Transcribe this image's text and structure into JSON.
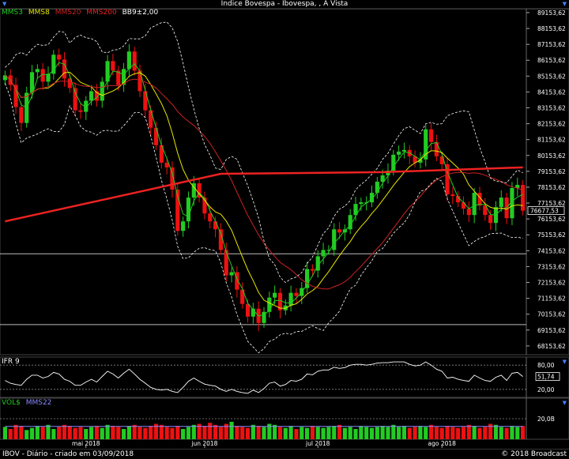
{
  "window": {
    "title": "Indice Bovespa - Ibovespa, , A Vista"
  },
  "legend_main": [
    {
      "label": "MMS3",
      "color": "#22cc22"
    },
    {
      "label": "MMS8",
      "color": "#e6e600"
    },
    {
      "label": "MMS20",
      "color": "#cc2222"
    },
    {
      "label": "MMS200",
      "color": "#ee2222"
    },
    {
      "label": "BB9±2,00",
      "color": "#ffffff"
    }
  ],
  "legend_ifr": {
    "label": "IFR 9",
    "color": "#ffffff"
  },
  "legend_vol": [
    {
      "label": "VOL$",
      "color": "#22cc22"
    },
    {
      "label": "MMS22",
      "color": "#8888ff"
    }
  ],
  "footer": {
    "left": "IBOV - Diário - criado em 03/09/2018",
    "right": "© 2018 Broadcast"
  },
  "colors": {
    "up": "#22cc22",
    "down": "#ee1111",
    "accent": "#4a7cff"
  },
  "chart_data": [
    {
      "type": "candlestick",
      "y_tick_labels": [
        "89153,62",
        "88153,62",
        "87153,62",
        "86153,62",
        "85153,62",
        "84153,62",
        "83153,62",
        "82153,62",
        "81153,62",
        "80153,62",
        "79153,62",
        "78153,62",
        "77153,62",
        "76153,62",
        "75153,62",
        "74153,62",
        "73153,62",
        "72153,62",
        "71153,62",
        "70153,62",
        "69153,62",
        "68153,62"
      ],
      "ylim": [
        67600,
        89400
      ],
      "last_value_label": "76677,53",
      "last_value": 76677.53,
      "horizontal_lines": [
        73960,
        69500
      ],
      "x_tick_labels": [
        {
          "label": "mai 2018",
          "index": 15
        },
        {
          "label": "jun 2018",
          "index": 37
        },
        {
          "label": "jul 2018",
          "index": 58
        },
        {
          "label": "ago 2018",
          "index": 81
        }
      ],
      "closes": [
        85200,
        84600,
        83200,
        82200,
        84100,
        85400,
        85600,
        84800,
        85300,
        86500,
        86200,
        85000,
        84400,
        83000,
        82900,
        83600,
        84200,
        83600,
        84800,
        86100,
        85500,
        84600,
        85600,
        86700,
        85500,
        84200,
        83000,
        81900,
        80800,
        79700,
        79400,
        78000,
        75400,
        76000,
        77500,
        78400,
        77500,
        76500,
        76000,
        75500,
        74200,
        72600,
        72800,
        71700,
        70800,
        70000,
        70500,
        69600,
        70300,
        71200,
        71500,
        70400,
        70700,
        71500,
        71300,
        71800,
        73000,
        72900,
        73800,
        74200,
        74200,
        75500,
        75300,
        75500,
        76400,
        77100,
        77200,
        77200,
        77800,
        78500,
        78900,
        79200,
        80200,
        80400,
        80500,
        80100,
        79700,
        79900,
        81800,
        81000,
        80100,
        79600,
        77700,
        77600,
        77200,
        76800,
        76400,
        77800,
        77000,
        76400,
        75900,
        76900,
        77500,
        76200,
        78100,
        78300,
        76677.53
      ],
      "ma_series": [
        {
          "name": "MMS3",
          "period": 3,
          "color": "#22cc22"
        },
        {
          "name": "MMS8",
          "period": 8,
          "color": "#e6e600"
        },
        {
          "name": "MMS20",
          "period": 20,
          "color": "#cc2222"
        }
      ],
      "mms200_path": [
        [
          0,
          76000
        ],
        [
          40,
          79000
        ],
        [
          70,
          79100
        ],
        [
          96,
          79400
        ]
      ],
      "bollinger": {
        "period": 9,
        "mult": 2.0,
        "color": "#ffffff"
      }
    },
    {
      "type": "line",
      "title": "IFR 9",
      "ylim": [
        0,
        100
      ],
      "y_tick_labels": [
        "80,00",
        "20,00"
      ],
      "y_ticks": [
        80,
        20
      ],
      "last_value_label": "51,74",
      "last_value": 51.74,
      "values": [
        42,
        35,
        32,
        30,
        45,
        55,
        55,
        48,
        52,
        62,
        58,
        45,
        40,
        30,
        30,
        38,
        45,
        38,
        52,
        65,
        58,
        48,
        60,
        70,
        58,
        45,
        35,
        25,
        20,
        18,
        20,
        15,
        12,
        25,
        40,
        48,
        40,
        33,
        30,
        28,
        20,
        15,
        20,
        15,
        12,
        10,
        18,
        12,
        22,
        35,
        38,
        28,
        32,
        42,
        40,
        45,
        58,
        56,
        65,
        68,
        68,
        75,
        72,
        74,
        80,
        82,
        82,
        80,
        82,
        85,
        86,
        86,
        88,
        88,
        88,
        82,
        78,
        80,
        88,
        80,
        70,
        65,
        48,
        50,
        45,
        42,
        40,
        55,
        48,
        42,
        40,
        50,
        55,
        42,
        60,
        62,
        51.74
      ]
    },
    {
      "type": "bar",
      "title": "VOL$",
      "y_tick_labels": [
        "20,0B"
      ],
      "y_ticks": [
        20
      ],
      "ylim": [
        0,
        40
      ],
      "volumes": [
        12,
        10,
        14,
        13,
        9,
        11,
        13,
        12,
        14,
        10,
        12,
        14,
        13,
        11,
        12,
        10,
        12,
        13,
        11,
        14,
        13,
        12,
        10,
        13,
        14,
        12,
        11,
        13,
        15,
        14,
        12,
        11,
        13,
        10,
        12,
        14,
        15,
        13,
        16,
        14,
        12,
        15,
        17,
        13,
        12,
        11,
        14,
        13,
        12,
        15,
        14,
        12,
        11,
        13,
        10,
        12,
        11,
        13,
        12,
        11,
        12,
        13,
        14,
        11,
        12,
        10,
        13,
        12,
        11,
        12,
        13,
        12,
        14,
        12,
        13,
        11,
        12,
        13,
        12,
        14,
        12,
        11,
        13,
        12,
        11,
        12,
        14,
        13,
        11,
        12,
        15,
        14,
        12,
        11,
        13,
        12,
        13
      ],
      "mms22": 12.5
    }
  ]
}
